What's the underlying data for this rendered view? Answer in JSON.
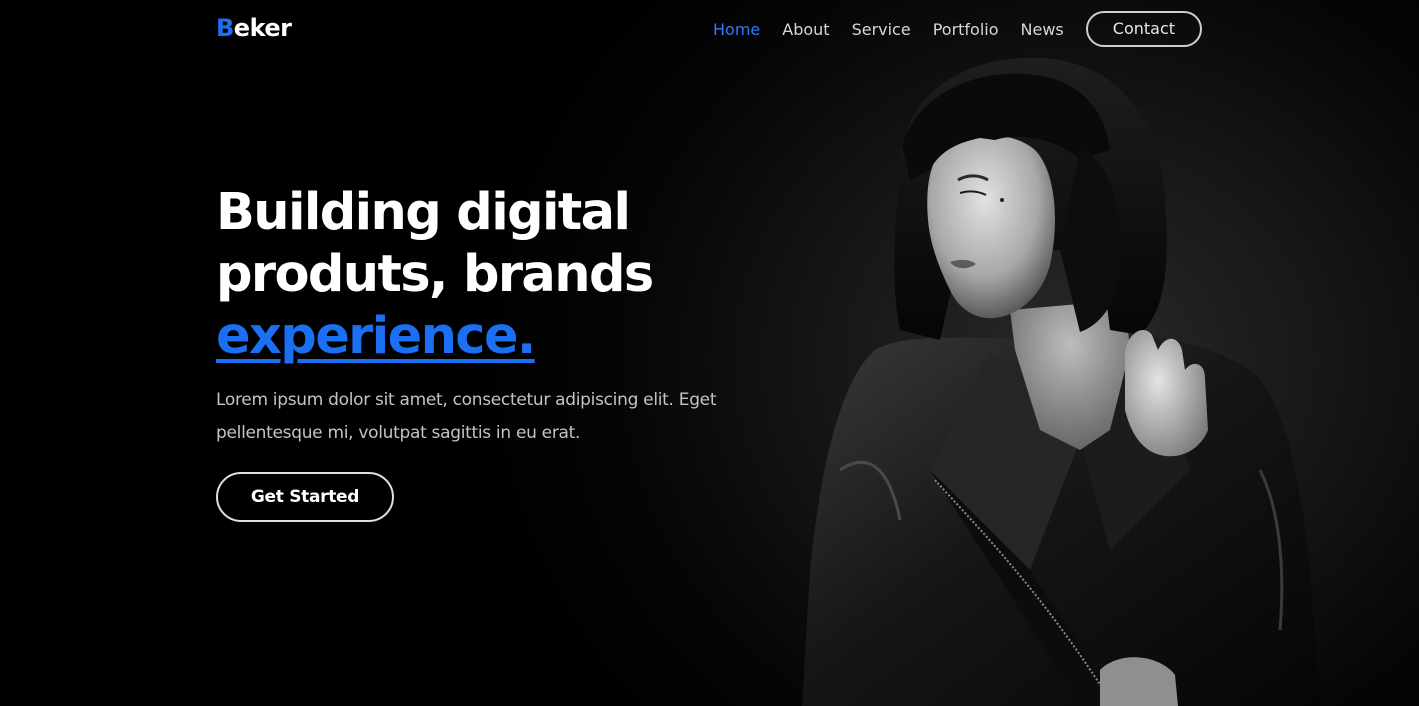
{
  "brand": {
    "accent_letter": "B",
    "rest": "eker",
    "accent_color": "#1a6ff2"
  },
  "nav": {
    "items": [
      {
        "label": "Home",
        "active": true
      },
      {
        "label": "About"
      },
      {
        "label": "Service"
      },
      {
        "label": "Portfolio"
      },
      {
        "label": "News"
      }
    ],
    "contact_label": "Contact"
  },
  "hero": {
    "headline_line1": "Building digital",
    "headline_line2": "produts, brands",
    "headline_highlight": "experience.",
    "lead": "Lorem ipsum dolor sit amet, consectetur adipiscing elit. Eget pellentesque mi, volutpat sagittis in eu erat.",
    "cta_label": "Get Started"
  },
  "colors": {
    "background": "#000000",
    "text": "#ffffff",
    "muted": "#c4c4c4",
    "active_nav": "#2b7cf5"
  }
}
